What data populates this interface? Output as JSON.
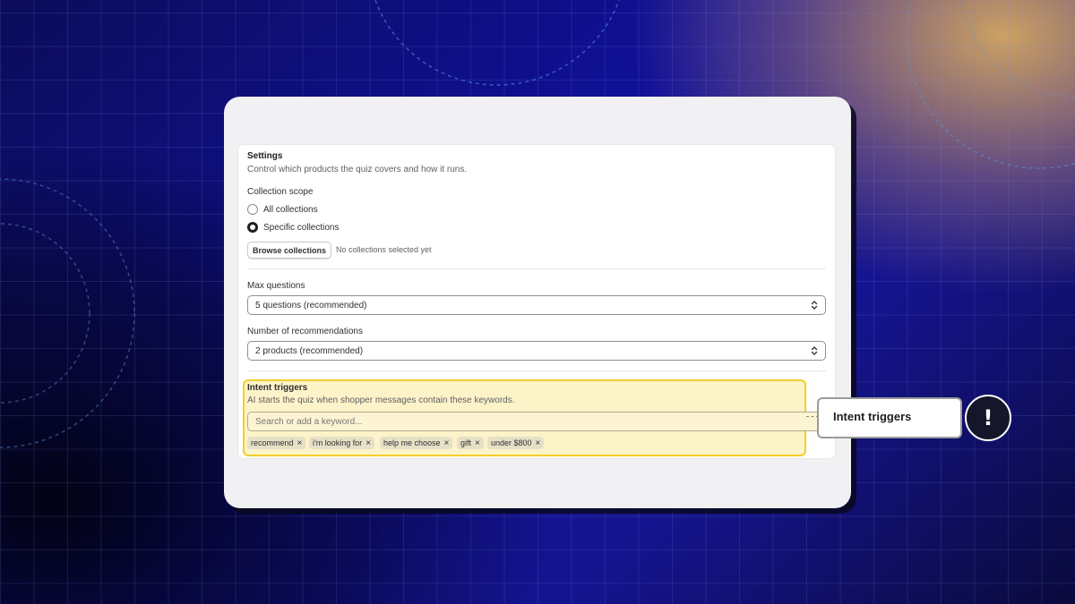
{
  "settings": {
    "title": "Settings",
    "description": "Control which products the quiz covers and how it runs."
  },
  "collection_scope": {
    "label": "Collection scope",
    "options": [
      {
        "label": "All collections",
        "selected": false
      },
      {
        "label": "Specific collections",
        "selected": true
      }
    ],
    "browse_button": "Browse collections",
    "status": "No collections selected yet"
  },
  "max_questions": {
    "label": "Max questions",
    "value": "5 questions (recommended)"
  },
  "recommendations": {
    "label": "Number of recommendations",
    "value": "2 products (recommended)"
  },
  "intent_triggers": {
    "label": "Intent triggers",
    "description": "AI starts the quiz when shopper messages contain these keywords.",
    "search_placeholder": "Search or add a keyword...",
    "keywords": [
      "recommend",
      "i'm looking for",
      "help me choose",
      "gift",
      "under $800"
    ],
    "remove_glyph": "×"
  },
  "callout": {
    "label": "Intent triggers",
    "alert_glyph": "!"
  },
  "colors": {
    "highlight_fill": "#fdf3c9",
    "highlight_border": "#f2cf2a",
    "alert_bg": "#15162a"
  }
}
